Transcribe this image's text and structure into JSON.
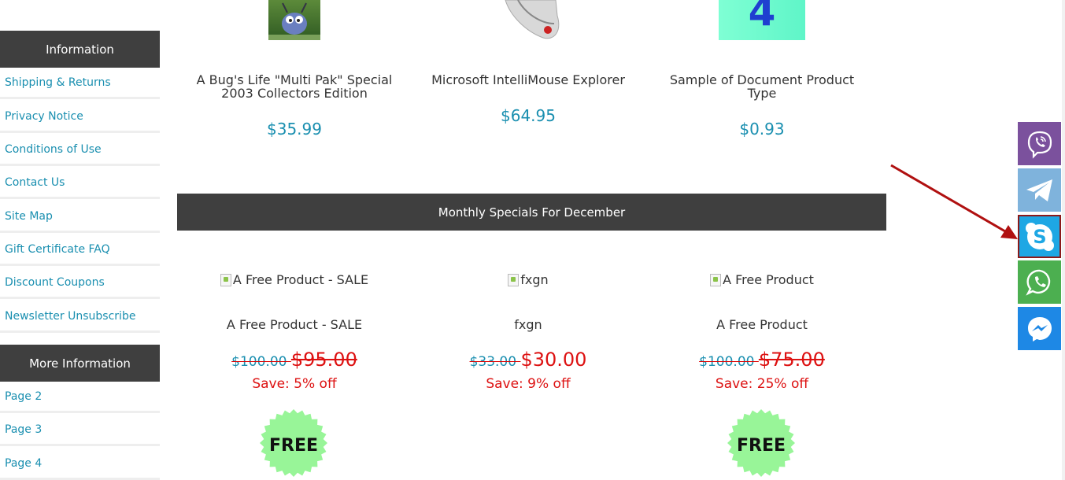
{
  "sidebar": {
    "information_title": "Information",
    "info_links": [
      "Shipping & Returns",
      "Privacy Notice",
      "Conditions of Use",
      "Contact Us",
      "Site Map",
      "Gift Certificate FAQ",
      "Discount Coupons",
      "Newsletter Unsubscribe"
    ],
    "more_title": "More Information",
    "more_links": [
      "Page 2",
      "Page 3",
      "Page 4"
    ]
  },
  "products": [
    {
      "name_line1": "A Bug's Life \"Multi Pak\" Special",
      "name_line2": "2003 Collectors Edition",
      "price": "$35.99"
    },
    {
      "name_line1": "Microsoft IntelliMouse Explorer",
      "name_line2": "",
      "price": "$64.95"
    },
    {
      "name_line1": "Sample of Document Product",
      "name_line2": "Type",
      "price": "$0.93",
      "thumb_digit": "4"
    }
  ],
  "specials": {
    "title": "Monthly Specials For December",
    "items": [
      {
        "img_alt": "A Free Product - SALE",
        "name": "A Free Product - SALE",
        "old_price": "$100.00 ",
        "new_price": "$95.00",
        "save": "Save: 5% off",
        "badge": "FREE"
      },
      {
        "img_alt": "fxgn",
        "name": "fxgn",
        "old_price": "$33.00 ",
        "new_price": "$30.00",
        "save": "Save: 9% off",
        "badge": ""
      },
      {
        "img_alt": "A Free Product",
        "name": "A Free Product",
        "old_price": "$100.00 ",
        "new_price": "$75.00",
        "save": "Save: 25% off",
        "badge": "FREE"
      }
    ]
  },
  "share_buttons": [
    {
      "name": "viber-icon",
      "color": "#7b519d"
    },
    {
      "name": "telegram-icon",
      "color": "#7fb3dc"
    },
    {
      "name": "skype-icon",
      "color": "#1ea7e4"
    },
    {
      "name": "whatsapp-icon",
      "color": "#4caf50"
    },
    {
      "name": "messenger-icon",
      "color": "#1e88e5"
    }
  ],
  "annotation_color": "#b01010"
}
